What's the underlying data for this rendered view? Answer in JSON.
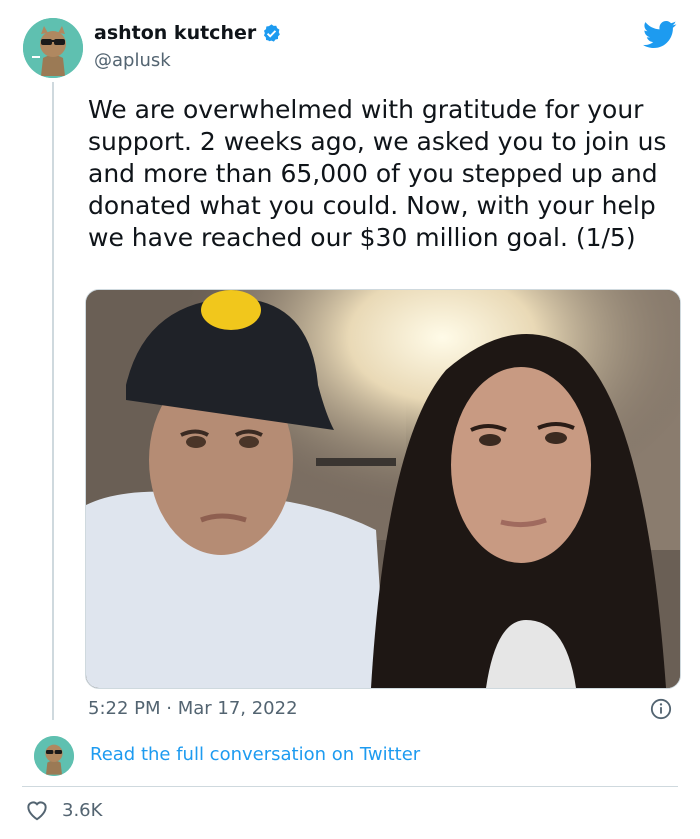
{
  "tweet": {
    "author_name": "ashton kutcher",
    "handle": "@aplusk",
    "text": "We are overwhelmed with gratitude for your support. 2 weeks ago, we asked you to join us and more than 65,000 of you stepped up and donated what you could. Now, with your help we have reached our $30 million goal. (1/5)",
    "timestamp": "5:22 PM · Mar 17, 2022",
    "read_more": "Read the full conversation on Twitter",
    "likes": "3.6K"
  },
  "icons": {
    "brand": "twitter-bird-icon",
    "verified": "verified-badge-icon",
    "info": "info-icon",
    "like": "heart-icon"
  },
  "colors": {
    "accent": "#1d9bf0",
    "text": "#0f1419",
    "secondary": "#536471",
    "avatar_bg": "#5fc0b0"
  }
}
